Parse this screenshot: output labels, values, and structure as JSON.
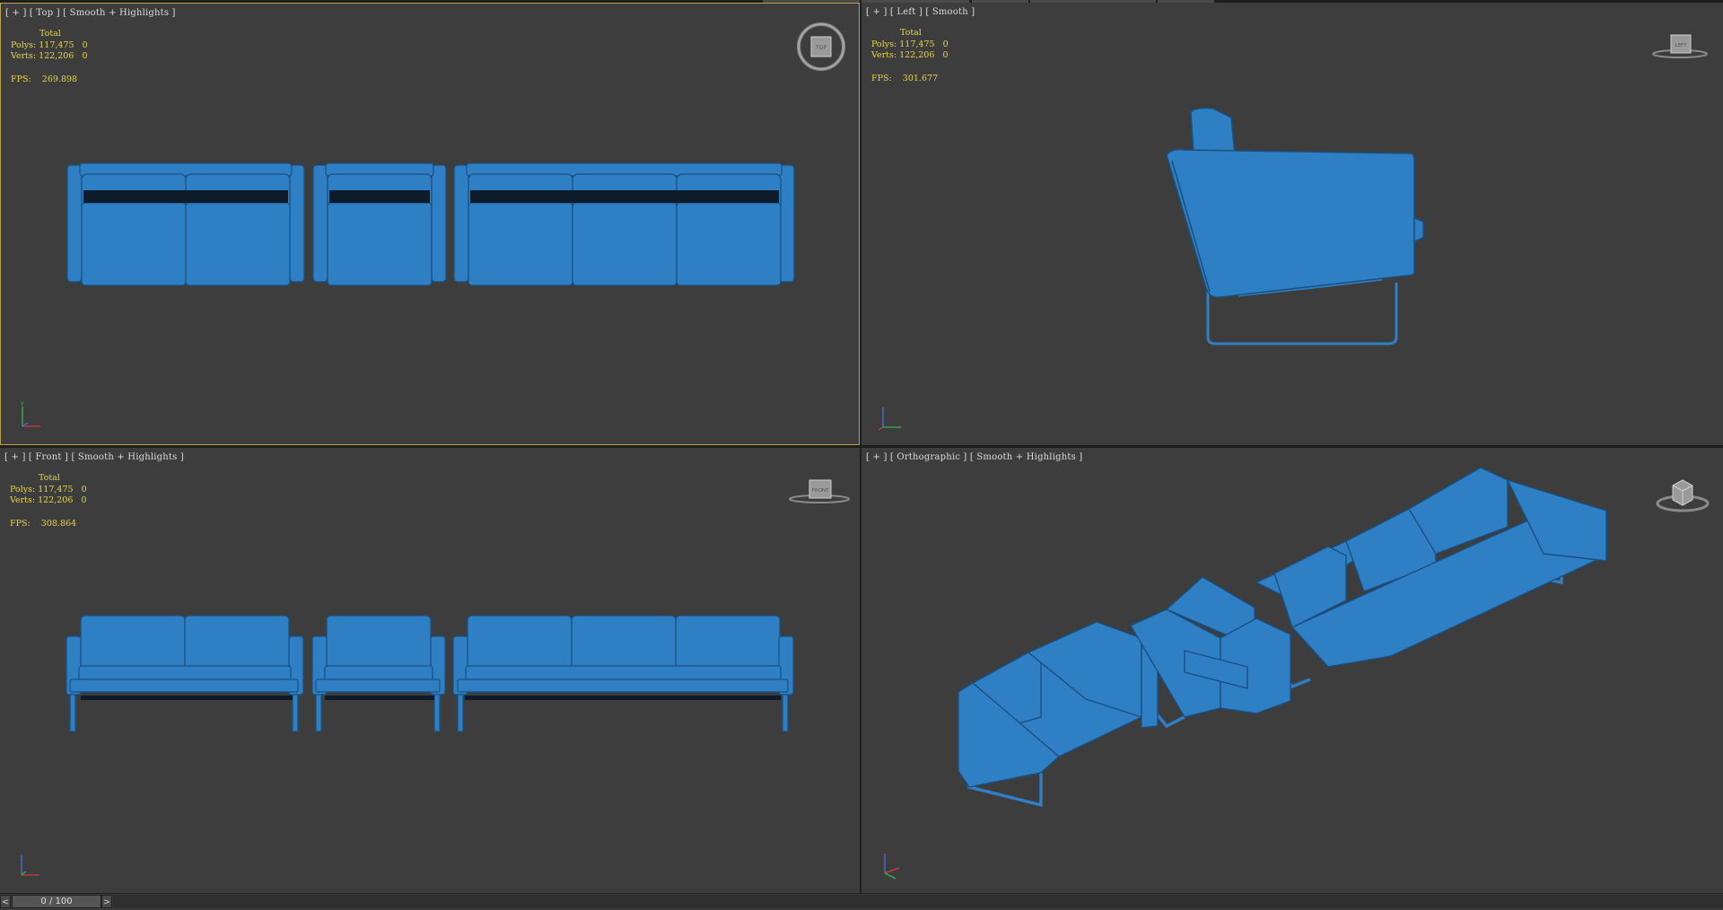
{
  "viewports": [
    {
      "id": "top",
      "label": "[ + ] [ Top ] [ Smooth + Highlights ]",
      "stats": {
        "total_label": "Total",
        "polys_label": "Polys:",
        "polys_total": "117,475",
        "polys_sel": "0",
        "verts_label": "Verts:",
        "verts_total": "122,206",
        "verts_sel": "0",
        "fps_label": "FPS:",
        "fps_value": "269.898"
      },
      "viewcube_text": "TOP",
      "active": true
    },
    {
      "id": "left",
      "label": "[ + ] [ Left ] [ Smooth ]",
      "stats": {
        "total_label": "Total",
        "polys_label": "Polys:",
        "polys_total": "117,475",
        "polys_sel": "0",
        "verts_label": "Verts:",
        "verts_total": "122,206",
        "verts_sel": "0",
        "fps_label": "FPS:",
        "fps_value": "301.677"
      },
      "viewcube_text": "LEFT",
      "active": false
    },
    {
      "id": "front",
      "label": "[ + ] [ Front ] [ Smooth + Highlights ]",
      "stats": {
        "total_label": "Total",
        "polys_label": "Polys:",
        "polys_total": "117,475",
        "polys_sel": "0",
        "verts_label": "Verts:",
        "verts_total": "122,206",
        "verts_sel": "0",
        "fps_label": "FPS:",
        "fps_value": "308.864"
      },
      "viewcube_text": "FRONT",
      "active": false
    },
    {
      "id": "ortho",
      "label": "[ + ] [ Orthographic ] [ Smooth + Highlights ]",
      "stats": null,
      "viewcube_text": "",
      "active": false
    }
  ],
  "timeline": {
    "position": "0 / 100",
    "prev": "<",
    "next": ">"
  },
  "colors": {
    "viewport_bg": "#3d3d3d",
    "model": "#2f7fc4",
    "model_dark": "#1d5c99",
    "stats_text": "#e8d44a",
    "active_border": "#b8a24a"
  }
}
